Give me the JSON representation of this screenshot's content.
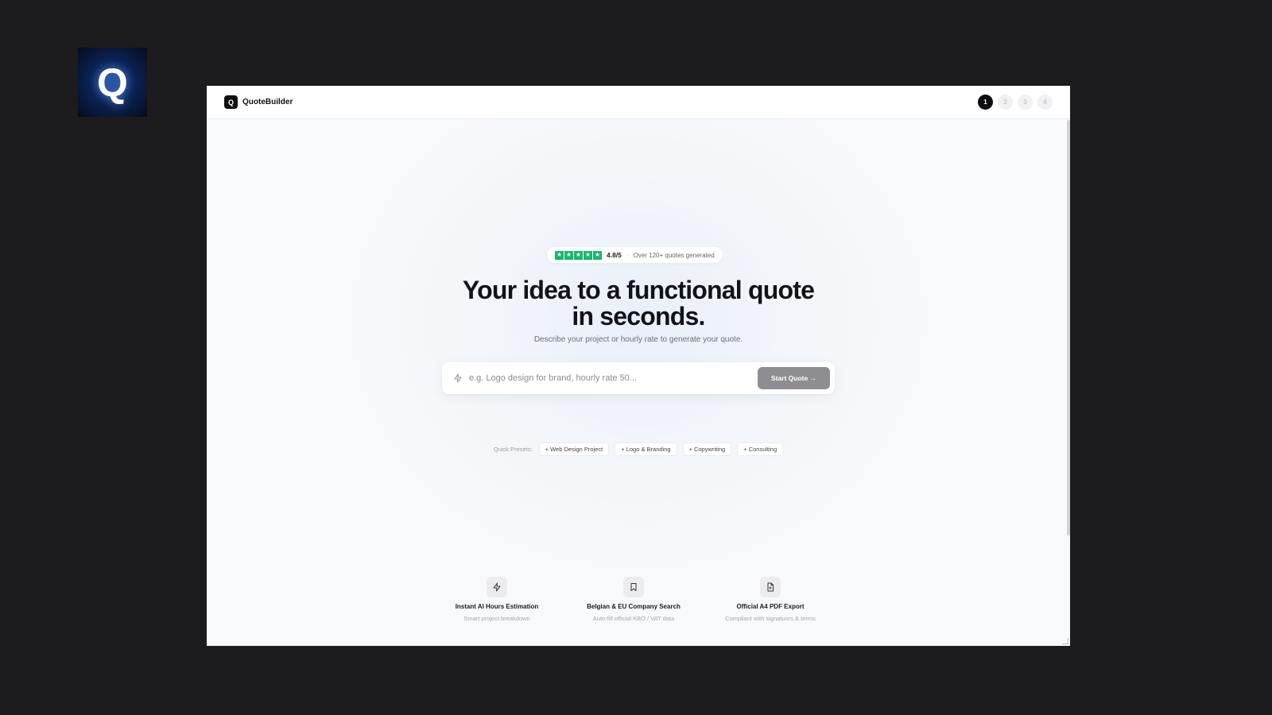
{
  "app_tile": {
    "glyph": "Q",
    "icon": "app-logo-q"
  },
  "topbar": {
    "brand_logo": "Q",
    "brand_name": "QuoteBuilder",
    "steps": [
      {
        "label": "1",
        "active": true
      },
      {
        "label": "2",
        "active": false
      },
      {
        "label": "3",
        "active": false
      },
      {
        "label": "4",
        "active": false
      }
    ]
  },
  "hero": {
    "rating": {
      "stars": 5,
      "star_color": "#14b86d",
      "score": "4.8/5",
      "separator": "·",
      "note": "Over 120+ quotes generated"
    },
    "headline_line1": "Your idea to a functional quote",
    "headline_line2": "in seconds.",
    "subline": "Describe your project or hourly rate to generate your quote."
  },
  "prompt": {
    "icon": "lightning-icon",
    "placeholder": "e.g. Logo design for brand, hourly rate 50...",
    "value": "",
    "button_label": "Start Quote →"
  },
  "presets": {
    "label": "Quick Presets:",
    "items": [
      "+ Web Design Project",
      "+ Logo & Branding",
      "+ Copywriting",
      "+ Consulting"
    ]
  },
  "features": [
    {
      "icon": "lightning-icon",
      "title": "Instant AI Hours Estimation",
      "subtitle": "Smart project breakdown"
    },
    {
      "icon": "bookmark-icon",
      "title": "Belgian & EU Company Search",
      "subtitle": "Auto-fill official KBO / VAT data"
    },
    {
      "icon": "document-icon",
      "title": "Official A4 PDF Export",
      "subtitle": "Compliant with signatures & terms"
    }
  ]
}
